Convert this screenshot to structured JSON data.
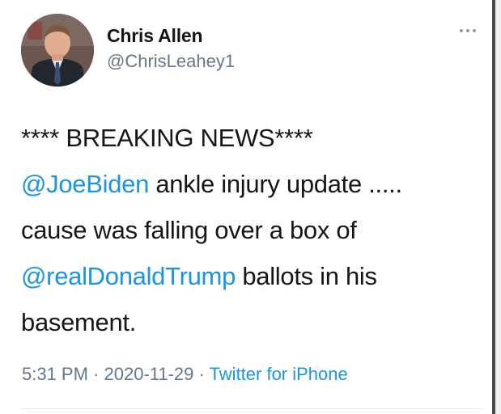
{
  "user": {
    "display_name": "Chris Allen",
    "handle": "@ChrisLeahey1"
  },
  "tweet": {
    "line1": "**** BREAKING NEWS****",
    "mention1": "@JoeBiden",
    "line2_rest": " ankle injury update .....",
    "line3": "cause was falling over a box of",
    "mention2": "@realDonaldTrump",
    "line4_rest": " ballots in his",
    "line5": "basement."
  },
  "meta": {
    "time": "5:31 PM",
    "sep1": " · ",
    "date": "2020-11-29",
    "sep2": " · ",
    "source": "Twitter for iPhone"
  },
  "icons": {
    "more": "more-options-icon",
    "avatar": "profile-avatar"
  },
  "colors": {
    "link": "#1b95e0",
    "text": "#14171a",
    "secondary": "#657786"
  }
}
